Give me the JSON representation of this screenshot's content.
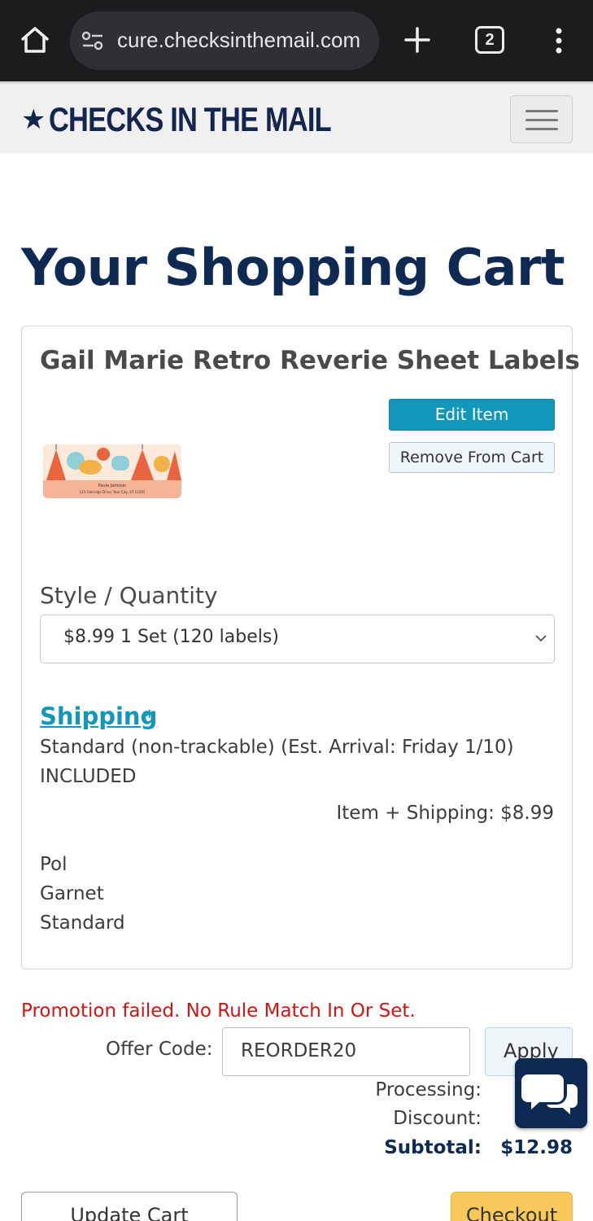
{
  "browser": {
    "url": "cure.checksinthemail.com",
    "tab_count": "2"
  },
  "header": {
    "logo_text": "CHECKS IN THE MAIL",
    "logo_reg": "®",
    "logo_star": "★"
  },
  "page": {
    "title": "Your Shopping Cart"
  },
  "cart_item": {
    "name": "Gail Marie Retro Reverie Sheet Labels",
    "edit_label": "Edit Item",
    "remove_label": "Remove From Cart",
    "thumb_line1": "Paula Jamison",
    "thumb_line2": "123 Oakridge Drive, Your City, ST 12345",
    "style_quantity_label": "Style / Quantity",
    "selected_option": "$8.99 1 Set (120 labels)",
    "shipping_label": "Shipping",
    "shipping_required_mark": "*",
    "shipping_method": "Standard (non-trackable) (Est. Arrival: Friday 1/10)",
    "shipping_price": "INCLUDED",
    "item_shipping_total": "Item + Shipping: $8.99",
    "attributes": [
      "Pol",
      "Garnet",
      "Standard"
    ]
  },
  "promo": {
    "error_message": "Promotion failed. No Rule Match In Or Set.",
    "offer_label": "Offer Code:",
    "offer_value": "REORDER20",
    "apply_label": "Apply"
  },
  "summary": {
    "processing_label": "Processing:",
    "discount_label": "Discount:",
    "subtotal_label": "Subtotal:",
    "subtotal_value": "$12.98"
  },
  "actions": {
    "update_label": "Update Cart",
    "checkout_label": "Checkout"
  },
  "colors": {
    "brand_navy": "#0f2a52",
    "accent_teal": "#1197b9",
    "error_red": "#d21414",
    "checkout_yellow": "#f7c95a"
  }
}
